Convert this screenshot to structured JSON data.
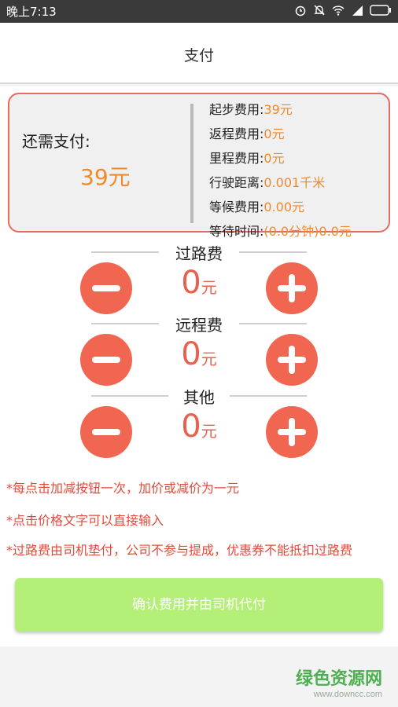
{
  "status_bar": {
    "time": "晚上7:13",
    "icons": [
      "alarm-icon",
      "mute-icon",
      "wifi-icon",
      "signal-icon",
      "battery-icon"
    ]
  },
  "header": {
    "title": "支付"
  },
  "summary": {
    "due_label": "还需支付:",
    "due_amount": "39元",
    "details": [
      {
        "label": "起步费用:",
        "value": "39元"
      },
      {
        "label": "返程费用:",
        "value": "0元"
      },
      {
        "label": "里程费用:",
        "value": "0元"
      },
      {
        "label": "行驶距离:",
        "value": "0.001千米"
      },
      {
        "label": "等候费用:",
        "value": "0.00元"
      },
      {
        "label": "等待时间:",
        "value": "(0.0分钟)0.0元"
      }
    ]
  },
  "fees": [
    {
      "title": "过路费",
      "amount": "0",
      "unit": "元"
    },
    {
      "title": "远程费",
      "amount": "0",
      "unit": "元"
    },
    {
      "title": "其他",
      "amount": "0",
      "unit": "元"
    }
  ],
  "notes": [
    "*每点击加减按钮一次，加价或减价为一元",
    "*点击价格文字可以直接输入",
    "*过路费由司机垫付，公司不参与提成，优惠券不能抵扣过路费"
  ],
  "confirm_button": {
    "label": "确认费用并由司机代付"
  },
  "watermark": {
    "main": "绿色资源网",
    "sub": "www.downcc.com"
  },
  "colors": {
    "accent_red": "#f16651",
    "amount_orange": "#ef8a2c",
    "note_red": "#e44a3a",
    "confirm_green": "#b4ef78"
  }
}
